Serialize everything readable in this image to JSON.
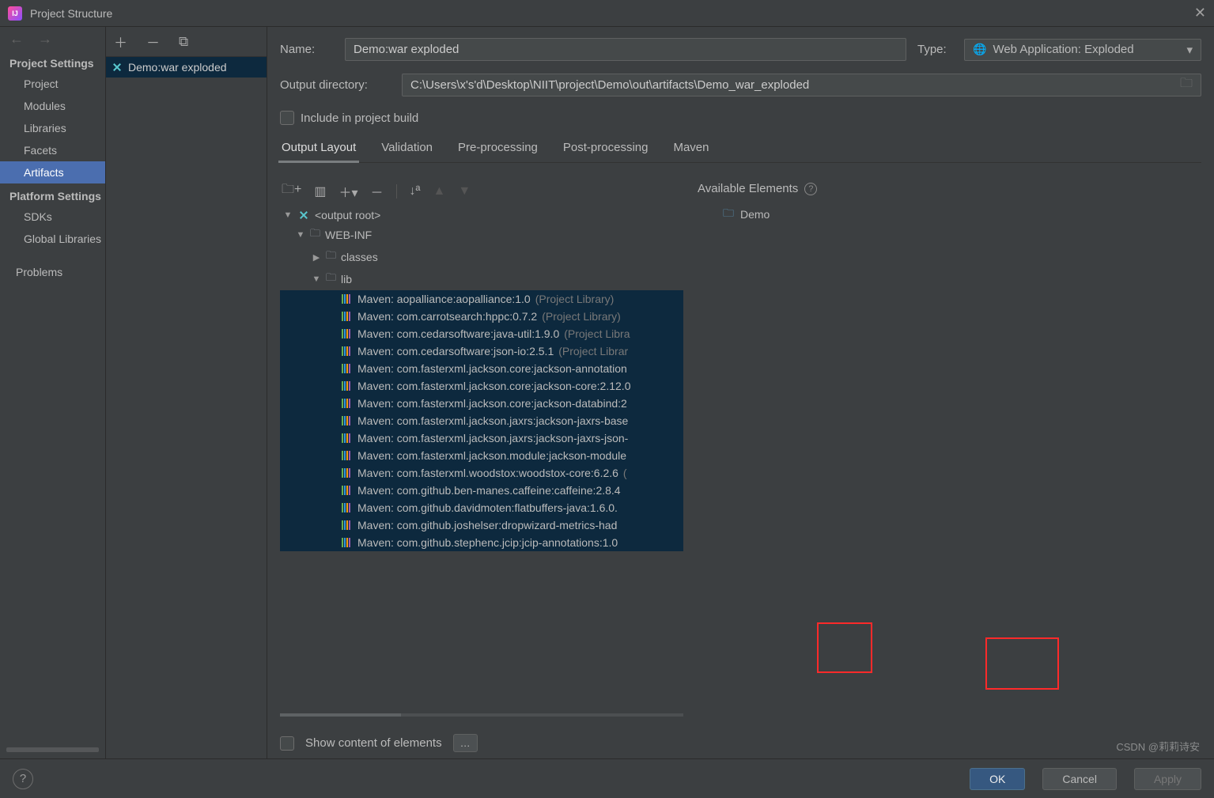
{
  "window": {
    "title": "Project Structure"
  },
  "sidebar": {
    "section1": "Project Settings",
    "items1": [
      "Project",
      "Modules",
      "Libraries",
      "Facets",
      "Artifacts"
    ],
    "section2": "Platform Settings",
    "items2": [
      "SDKs",
      "Global Libraries"
    ],
    "problems": "Problems"
  },
  "artifactList": {
    "item": "Demo:war exploded"
  },
  "form": {
    "name_label": "Name:",
    "name_value": "Demo:war exploded",
    "type_label": "Type:",
    "type_value": "Web Application: Exploded",
    "outdir_label": "Output directory:",
    "outdir_value": "C:\\Users\\x's'd\\Desktop\\NIIT\\project\\Demo\\out\\artifacts\\Demo_war_exploded",
    "include_label": "Include in project build"
  },
  "tabs": [
    "Output Layout",
    "Validation",
    "Pre-processing",
    "Post-processing",
    "Maven"
  ],
  "tree": {
    "root": "<output root>",
    "webinf": "WEB-INF",
    "classes": "classes",
    "lib": "lib",
    "libs": [
      {
        "t": "Maven: aopalliance:aopalliance:1.0",
        "tag": "(Project Library)"
      },
      {
        "t": "Maven: com.carrotsearch:hppc:0.7.2",
        "tag": "(Project Library)"
      },
      {
        "t": "Maven: com.cedarsoftware:java-util:1.9.0",
        "tag": "(Project Libra"
      },
      {
        "t": "Maven: com.cedarsoftware:json-io:2.5.1",
        "tag": "(Project Librar"
      },
      {
        "t": "Maven: com.fasterxml.jackson.core:jackson-annotation",
        "tag": ""
      },
      {
        "t": "Maven: com.fasterxml.jackson.core:jackson-core:2.12.0",
        "tag": ""
      },
      {
        "t": "Maven: com.fasterxml.jackson.core:jackson-databind:2",
        "tag": ""
      },
      {
        "t": "Maven: com.fasterxml.jackson.jaxrs:jackson-jaxrs-base",
        "tag": ""
      },
      {
        "t": "Maven: com.fasterxml.jackson.jaxrs:jackson-jaxrs-json-",
        "tag": ""
      },
      {
        "t": "Maven: com.fasterxml.jackson.module:jackson-module",
        "tag": ""
      },
      {
        "t": "Maven: com.fasterxml.woodstox:woodstox-core:6.2.6",
        "tag": "("
      },
      {
        "t": "Maven: com.github.ben-manes.caffeine:caffeine:2.8.4",
        "tag": ""
      },
      {
        "t": "Maven: com.github.davidmoten:flatbuffers-java:1.6.0.",
        "tag": ""
      },
      {
        "t": "Maven: com.github.joshelser:dropwizard-metrics-had",
        "tag": ""
      },
      {
        "t": "Maven: com.github.stephenc.jcip:jcip-annotations:1.0",
        "tag": ""
      }
    ]
  },
  "avail": {
    "header": "Available Elements",
    "item": "Demo"
  },
  "show_content": "Show content of elements",
  "buttons": {
    "ok": "OK",
    "cancel": "Cancel",
    "apply": "Apply"
  },
  "watermark": "CSDN @莉莉诗安"
}
